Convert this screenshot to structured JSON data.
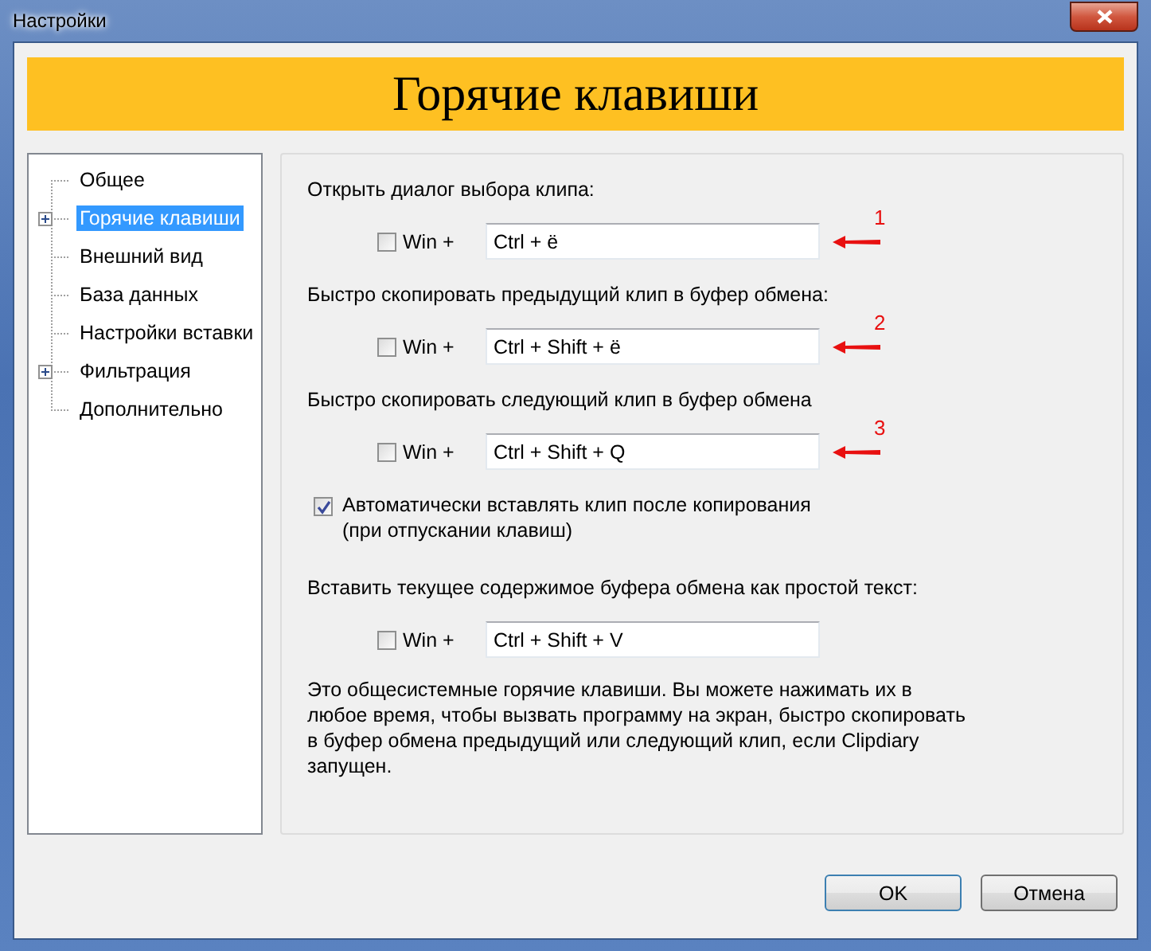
{
  "window": {
    "title": "Настройки"
  },
  "header": {
    "title": "Горячие клавиши"
  },
  "tree": [
    {
      "label": "Общее",
      "kind": "leaf",
      "selected": false
    },
    {
      "label": "Горячие клавиши",
      "kind": "branch",
      "expanded": false,
      "selected": true
    },
    {
      "label": "Внешний вид",
      "kind": "leaf",
      "selected": false
    },
    {
      "label": "База данных",
      "kind": "leaf",
      "selected": false
    },
    {
      "label": "Настройки вставки",
      "kind": "leaf",
      "selected": false
    },
    {
      "label": "Фильтрация",
      "kind": "branch",
      "expanded": false,
      "selected": false
    },
    {
      "label": "Дополнительно",
      "kind": "leaf",
      "selected": false
    }
  ],
  "sections": [
    {
      "kind": "shortcut",
      "label": "Открыть диалог выбора клипа:",
      "win_checked": false,
      "win_label": "Win +",
      "value": "Ctrl + ё",
      "marker": "1"
    },
    {
      "kind": "shortcut",
      "label": "Быстро скопировать предыдущий клип в буфер обмена:",
      "win_checked": false,
      "win_label": "Win +",
      "value": "Ctrl + Shift + ё",
      "marker": "2"
    },
    {
      "kind": "shortcut",
      "label": "Быстро скопировать следующий клип в буфер обмена",
      "win_checked": false,
      "win_label": "Win +",
      "value": "Ctrl + Shift + Q",
      "marker": "3"
    },
    {
      "kind": "option",
      "label": "Автоматически вставлять клип после копирования\n(при отпускании клавиш)",
      "checked": true
    },
    {
      "kind": "shortcut",
      "label": "Вставить текущее содержимое буфера обмена как простой текст:",
      "win_checked": false,
      "win_label": "Win +",
      "value": "Ctrl + Shift + V"
    }
  ],
  "note": "Это общесистемные горячие клавиши. Вы можете нажимать их в любое время, чтобы вызвать программу на экран, быстро скопировать в буфер обмена предыдущий или следующий клип, если Clipdiary запущен.",
  "buttons": [
    {
      "label": "OK",
      "kind": "default"
    },
    {
      "label": "Отмена",
      "kind": "normal"
    }
  ]
}
